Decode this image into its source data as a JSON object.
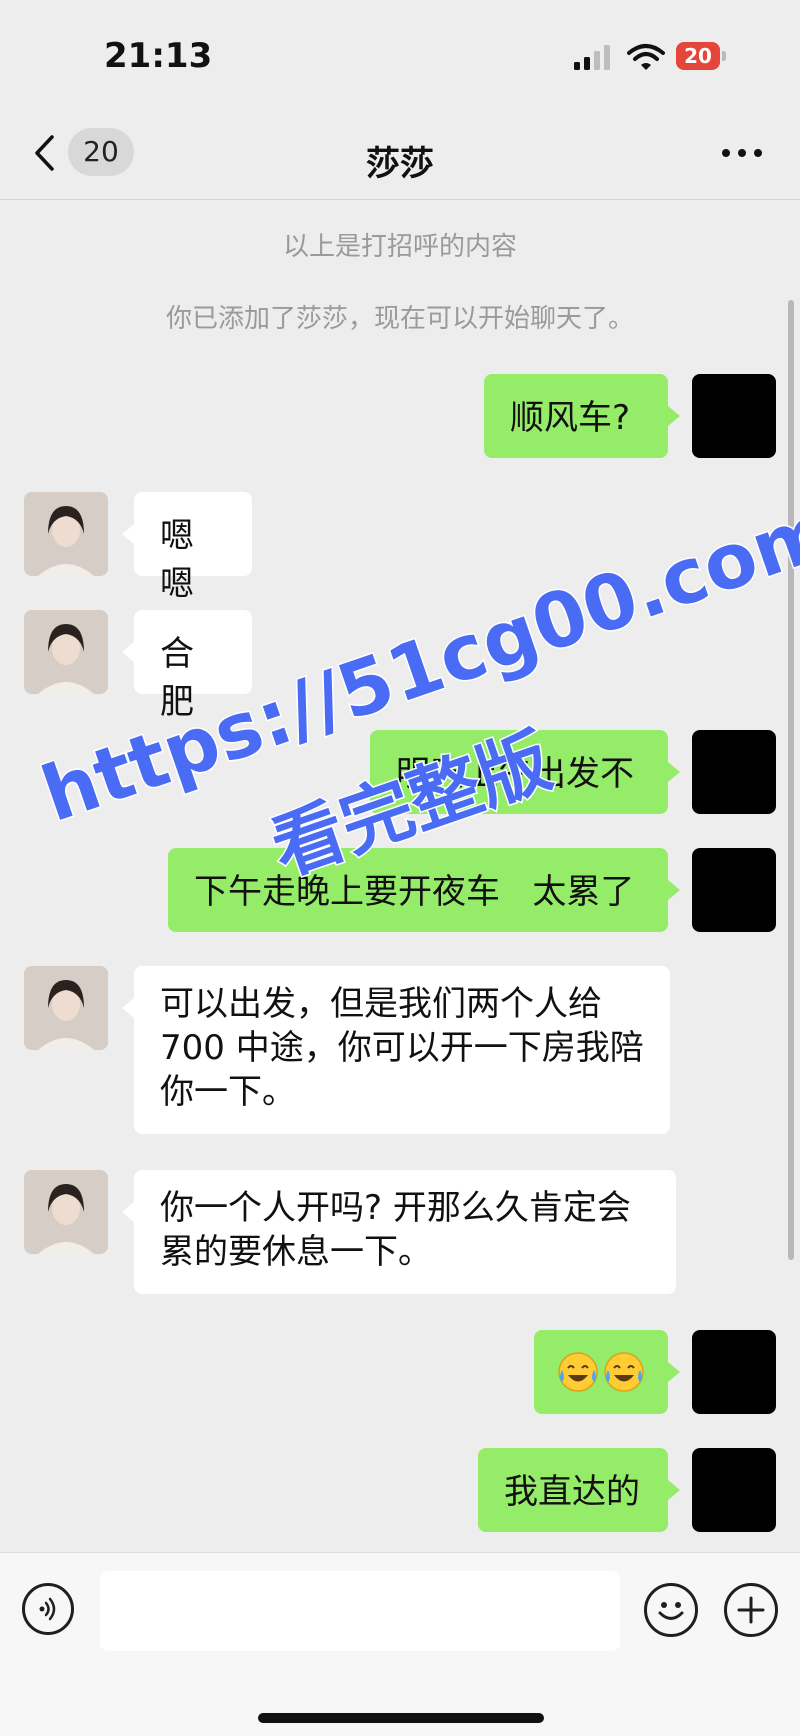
{
  "status_bar": {
    "time": "21:13",
    "battery_level": "20",
    "battery_color": "#e5463b"
  },
  "nav": {
    "unread_count": "20",
    "title": "莎莎"
  },
  "system_notices": [
    "以上是打招呼的内容",
    "你已添加了莎莎，现在可以开始聊天了。"
  ],
  "messages": [
    {
      "from": "self",
      "lines": [
        "顺风车?"
      ]
    },
    {
      "from": "contact",
      "lines": [
        "嗯嗯"
      ]
    },
    {
      "from": "contact",
      "lines": [
        "合肥"
      ]
    },
    {
      "from": "self",
      "lines": [
        "明天上午出发不"
      ]
    },
    {
      "from": "self",
      "lines": [
        "下午走晚上要开夜车   太累了"
      ]
    },
    {
      "from": "contact",
      "lines": [
        "可以出发，但是我们两个人给",
        "700 中途，你可以开一下房我陪",
        "你一下。"
      ]
    },
    {
      "from": "contact",
      "lines": [
        "你一个人开吗? 开那么久肯定会",
        "累的要休息一下。"
      ]
    },
    {
      "from": "self",
      "emoji": [
        "crying-laughing-emoji",
        "crying-laughing-emoji"
      ]
    },
    {
      "from": "self",
      "lines": [
        "我直达的"
      ]
    }
  ],
  "watermark": {
    "url": "https://51cg00.com",
    "caption": "看完整版",
    "color": "#4a6cf5"
  },
  "input_bar": {
    "message_value": "",
    "icons": [
      "voice-icon",
      "emoji-icon",
      "plus-icon"
    ]
  },
  "colors": {
    "outgoing_bubble": "#95ec69",
    "incoming_bubble": "#ffffff",
    "background": "#ededed"
  }
}
